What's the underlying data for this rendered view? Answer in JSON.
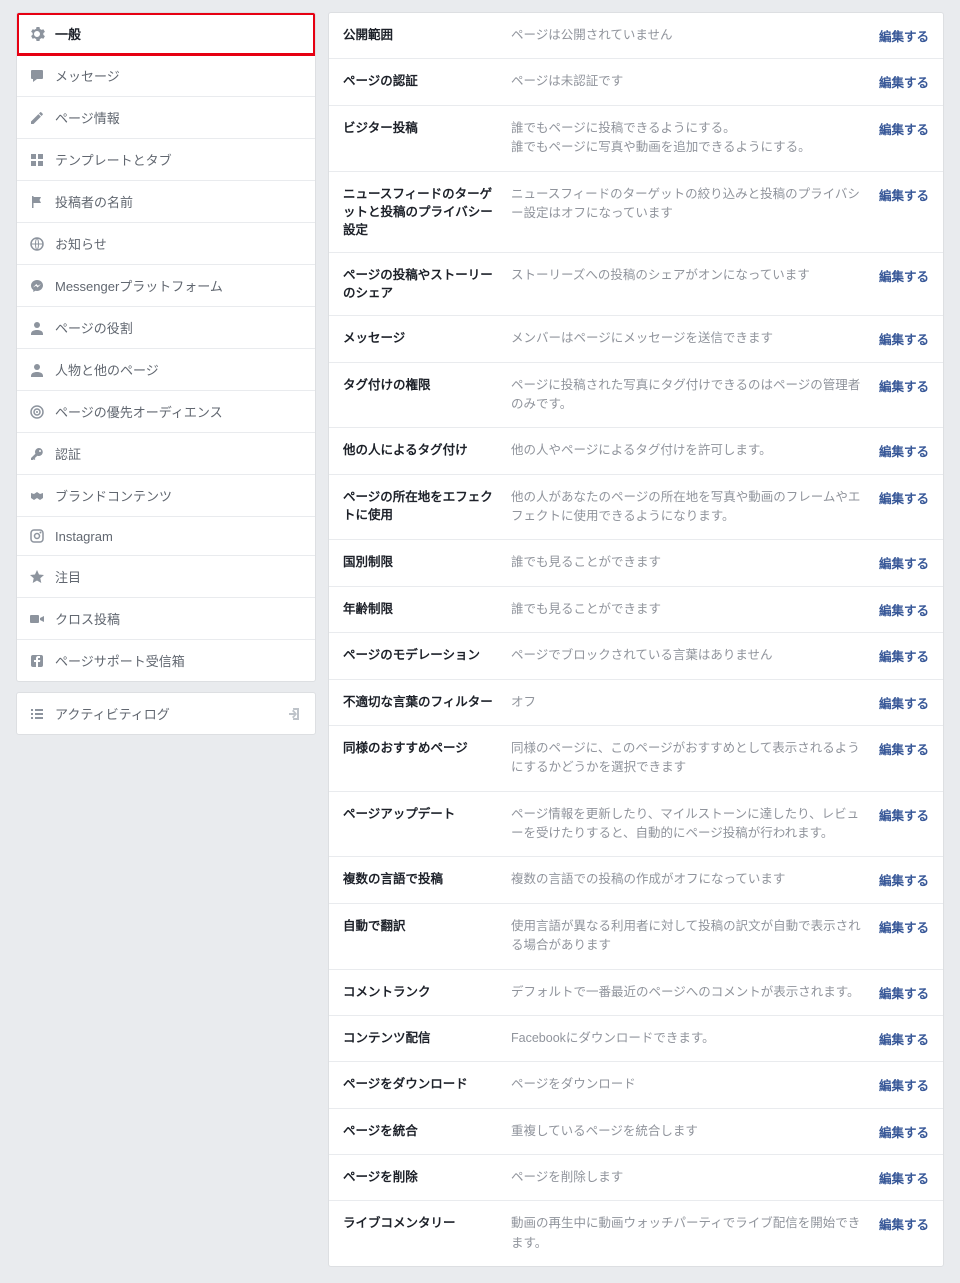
{
  "editLabel": "編集する",
  "sidebar": {
    "items": [
      {
        "label": "一般",
        "icon": "gear",
        "active": true
      },
      {
        "label": "メッセージ",
        "icon": "speech"
      },
      {
        "label": "ページ情報",
        "icon": "pencil"
      },
      {
        "label": "テンプレートとタブ",
        "icon": "grid"
      },
      {
        "label": "投稿者の名前",
        "icon": "flag"
      },
      {
        "label": "お知らせ",
        "icon": "globe"
      },
      {
        "label": "Messengerプラットフォーム",
        "icon": "messenger"
      },
      {
        "label": "ページの役割",
        "icon": "user"
      },
      {
        "label": "人物と他のページ",
        "icon": "user"
      },
      {
        "label": "ページの優先オーディエンス",
        "icon": "target"
      },
      {
        "label": "認証",
        "icon": "key"
      },
      {
        "label": "ブランドコンテンツ",
        "icon": "handshake"
      },
      {
        "label": "Instagram",
        "icon": "instagram"
      },
      {
        "label": "注目",
        "icon": "star"
      },
      {
        "label": "クロス投稿",
        "icon": "video"
      },
      {
        "label": "ページサポート受信箱",
        "icon": "fb"
      }
    ],
    "log": {
      "label": "アクティビティログ",
      "icon": "list"
    }
  },
  "settings": [
    {
      "label": "公開範囲",
      "desc": "ページは公開されていません"
    },
    {
      "label": "ページの認証",
      "desc": "ページは未認証です"
    },
    {
      "label": "ビジター投稿",
      "desc": "誰でもページに投稿できるようにする。\n誰でもページに写真や動画を追加できるようにする。"
    },
    {
      "label": "ニュースフィードのターゲットと投稿のプライバシー設定",
      "desc": "ニュースフィードのターゲットの絞り込みと投稿のプライバシー設定はオフになっています"
    },
    {
      "label": "ページの投稿やストーリーのシェア",
      "desc": "ストーリーズへの投稿のシェアがオンになっています"
    },
    {
      "label": "メッセージ",
      "desc": "メンバーはページにメッセージを送信できます"
    },
    {
      "label": "タグ付けの権限",
      "desc": "ページに投稿された写真にタグ付けできるのはページの管理者のみです。"
    },
    {
      "label": "他の人によるタグ付け",
      "desc": "他の人やページによるタグ付けを許可します。"
    },
    {
      "label": "ページの所在地をエフェクトに使用",
      "desc": "他の人があなたのページの所在地を写真や動画のフレームやエフェクトに使用できるようになります。"
    },
    {
      "label": "国別制限",
      "desc": "誰でも見ることができます"
    },
    {
      "label": "年齢制限",
      "desc": "誰でも見ることができます"
    },
    {
      "label": "ページのモデレーション",
      "desc": "ページでブロックされている言葉はありません"
    },
    {
      "label": "不適切な言葉のフィルター",
      "desc": "オフ"
    },
    {
      "label": "同様のおすすめページ",
      "desc": "同様のページに、このページがおすすめとして表示されるようにするかどうかを選択できます"
    },
    {
      "label": "ページアップデート",
      "desc": "ページ情報を更新したり、マイルストーンに達したり、レビューを受けたりすると、自動的にページ投稿が行われます。"
    },
    {
      "label": "複数の言語で投稿",
      "desc": "複数の言語での投稿の作成がオフになっています"
    },
    {
      "label": "自動で翻訳",
      "desc": "使用言語が異なる利用者に対して投稿の訳文が自動で表示される場合があります"
    },
    {
      "label": "コメントランク",
      "desc": "デフォルトで一番最近のページへのコメントが表示されます。"
    },
    {
      "label": "コンテンツ配信",
      "desc": "Facebookにダウンロードできます。"
    },
    {
      "label": "ページをダウンロード",
      "desc": "ページをダウンロード"
    },
    {
      "label": "ページを統合",
      "desc": "重複しているページを統合します"
    },
    {
      "label": "ページを削除",
      "desc": "ページを削除します"
    },
    {
      "label": "ライブコメンタリー",
      "desc": "動画の再生中に動画ウォッチパーティでライブ配信を開始できます。"
    }
  ]
}
